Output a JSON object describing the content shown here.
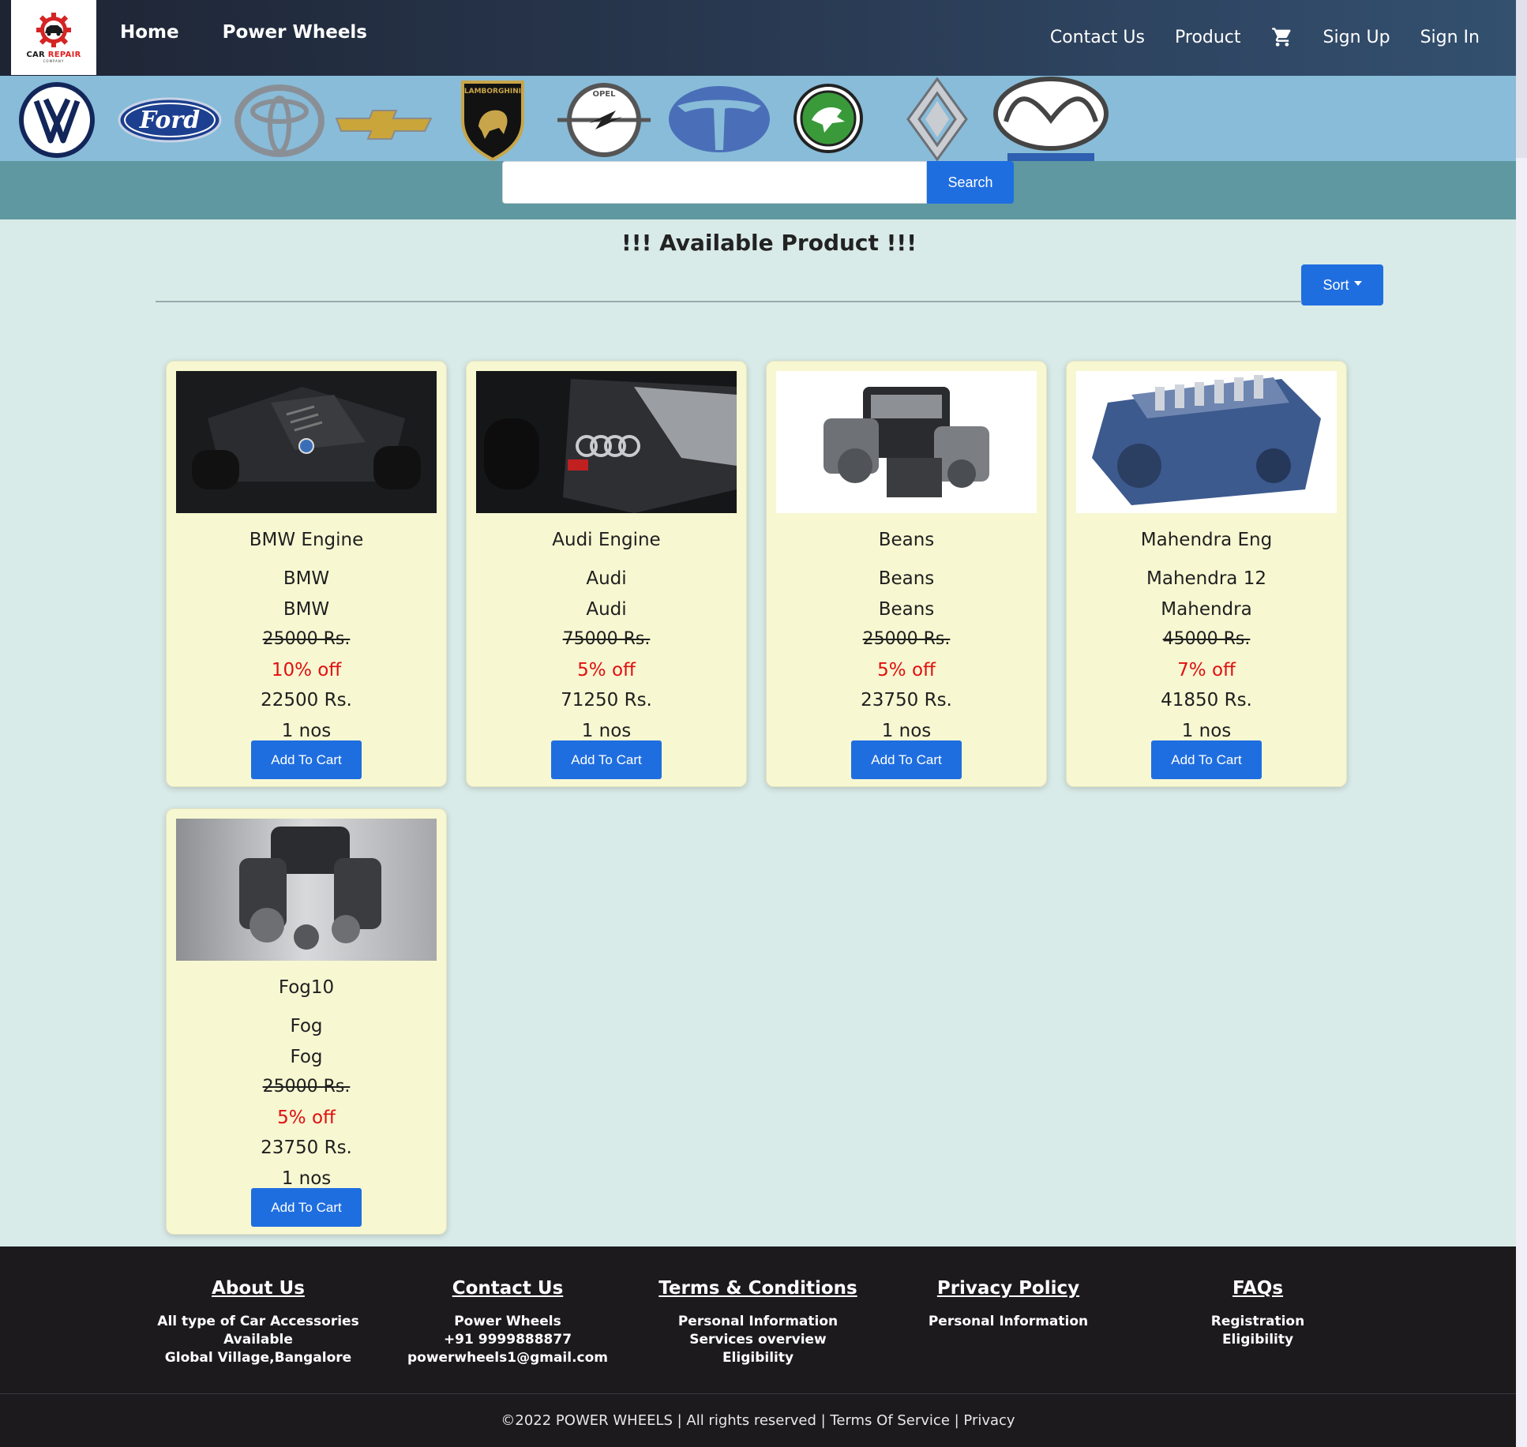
{
  "nav": {
    "logo_text_a": "CAR ",
    "logo_text_b": "REPAIR",
    "logo_sub": "COMPANY",
    "left_links": [
      "Home",
      "Power Wheels"
    ],
    "right_links": {
      "contact": "Contact Us",
      "product": "Product",
      "signup": "Sign Up",
      "signin": "Sign In"
    }
  },
  "brands": [
    "Volkswagen",
    "Ford",
    "Toyota",
    "Chevrolet",
    "Lamborghini",
    "Opel",
    "Tata",
    "Skoda",
    "Renault",
    "Mazda"
  ],
  "brand_texts": {
    "ford": "Ford",
    "lamborghini": "LAMBORGHINI",
    "opel": "OPEL"
  },
  "search": {
    "placeholder": "",
    "button": "Search"
  },
  "main": {
    "heading": "!!! Available Product !!!",
    "sort_label": "Sort"
  },
  "products": [
    {
      "name": "BMW Engine",
      "model": "BMW",
      "brand": "BMW",
      "original_price": "25000 Rs.",
      "discount": "10% off",
      "price": "22500 Rs.",
      "qty": "1 nos",
      "button": "Add To Cart"
    },
    {
      "name": "Audi Engine",
      "model": "Audi",
      "brand": "Audi",
      "original_price": "75000 Rs.",
      "discount": "5% off",
      "price": "71250 Rs.",
      "qty": "1 nos",
      "button": "Add To Cart"
    },
    {
      "name": "Beans",
      "model": "Beans",
      "brand": "Beans",
      "original_price": "25000 Rs.",
      "discount": "5% off",
      "price": "23750 Rs.",
      "qty": "1 nos",
      "button": "Add To Cart"
    },
    {
      "name": "Mahendra Eng",
      "model": "Mahendra 12",
      "brand": "Mahendra",
      "original_price": "45000 Rs.",
      "discount": "7% off",
      "price": "41850 Rs.",
      "qty": "1 nos",
      "button": "Add To Cart"
    },
    {
      "name": "Fog10",
      "model": "Fog",
      "brand": "Fog",
      "original_price": "25000 Rs.",
      "discount": "5% off",
      "price": "23750 Rs.",
      "qty": "1 nos",
      "button": "Add To Cart"
    }
  ],
  "footer": {
    "columns": [
      {
        "title": "About Us",
        "lines": [
          "All type of Car Accessories",
          "Available",
          "Global Village,Bangalore"
        ]
      },
      {
        "title": "Contact Us",
        "lines": [
          "Power Wheels",
          "+91 9999888877",
          "powerwheels1@gmail.com"
        ]
      },
      {
        "title": "Terms & Conditions",
        "lines": [
          "Personal Information",
          "Services overview",
          "Eligibility"
        ]
      },
      {
        "title": "Privacy Policy",
        "lines": [
          "Personal Information"
        ]
      },
      {
        "title": "FAQs",
        "lines": [
          "Registration",
          "Eligibility"
        ]
      }
    ],
    "copyright": "©2022 POWER WHEELS | All rights reserved | Terms Of Service | Privacy"
  },
  "colors": {
    "primary": "#1f6ee0",
    "discount": "#e01010",
    "card_bg": "#f7f7d2",
    "page_bg": "#d9ebe8",
    "footer_bg": "#1c1a1d"
  }
}
